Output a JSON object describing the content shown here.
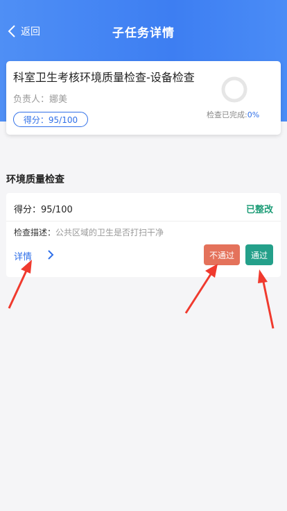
{
  "header": {
    "back_label": "返回",
    "title": "子任务详情"
  },
  "task": {
    "title": "科室卫生考核环境质量检查-设备检查",
    "owner_label": "负责人：娜美",
    "score_label": "得分：95/100",
    "progress_label": "检查已完成:",
    "progress_value": "0%",
    "progress_fraction": 0
  },
  "section": {
    "title": "环境质量检查"
  },
  "item": {
    "score_label": "得分：95/100",
    "status": "已整改",
    "desc_label": "检查描述：",
    "desc_value": "公共区域的卫生是否打扫干净",
    "detail_label": "详情",
    "fail_button": "不通过",
    "pass_button": "通过"
  },
  "colors": {
    "header_blue": "#3d7ef2",
    "accent_blue": "#2f6fe8",
    "status_green": "#1f9d78",
    "fail_orange": "#e4725b",
    "pass_teal": "#24a08a",
    "annotation_red": "#f03a2e"
  }
}
